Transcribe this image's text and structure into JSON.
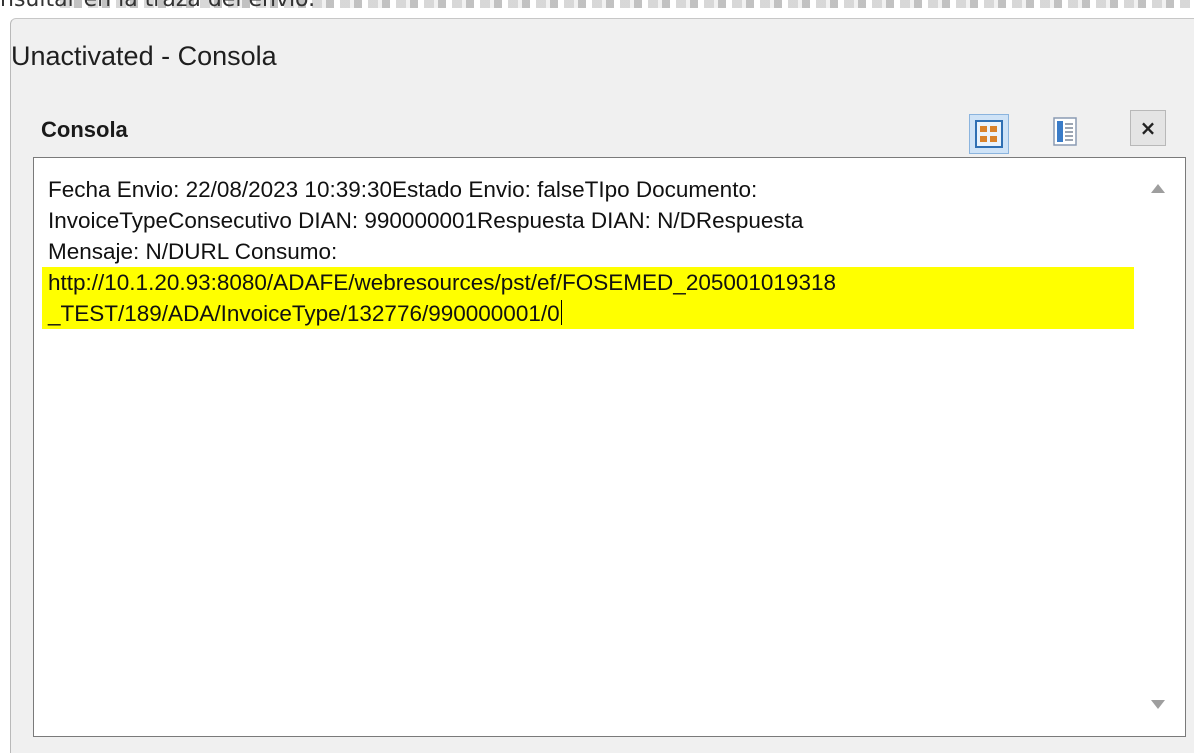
{
  "background": {
    "partial_text": "nsultar en la traza del envío."
  },
  "window": {
    "title": "Unactivated - Consola",
    "panel_title": "Consola"
  },
  "toolbar": {
    "icons": [
      "grid-view-icon",
      "list-view-icon",
      "close-icon"
    ],
    "close_label": "×"
  },
  "console": {
    "lines": [
      "Fecha Envio: 22/08/2023 10:39:30Estado Envio: falseTIpo Documento:",
      "InvoiceTypeConsecutivo DIAN: 990000001Respuesta DIAN: N/DRespuesta",
      "Mensaje: N/DURL Consumo:"
    ],
    "highlighted_lines": [
      "http://10.1.20.93:8080/ADAFE/webresources/pst/ef/FOSEMED_205001019318",
      "_TEST/189/ADA/InvoiceType/132776/990000001/0"
    ],
    "highlight_color": "#ffff00"
  },
  "colors": {
    "window_bg": "#f0f0f0",
    "active_button_bg": "#cfe3f7",
    "active_button_border": "#8bb4de"
  }
}
